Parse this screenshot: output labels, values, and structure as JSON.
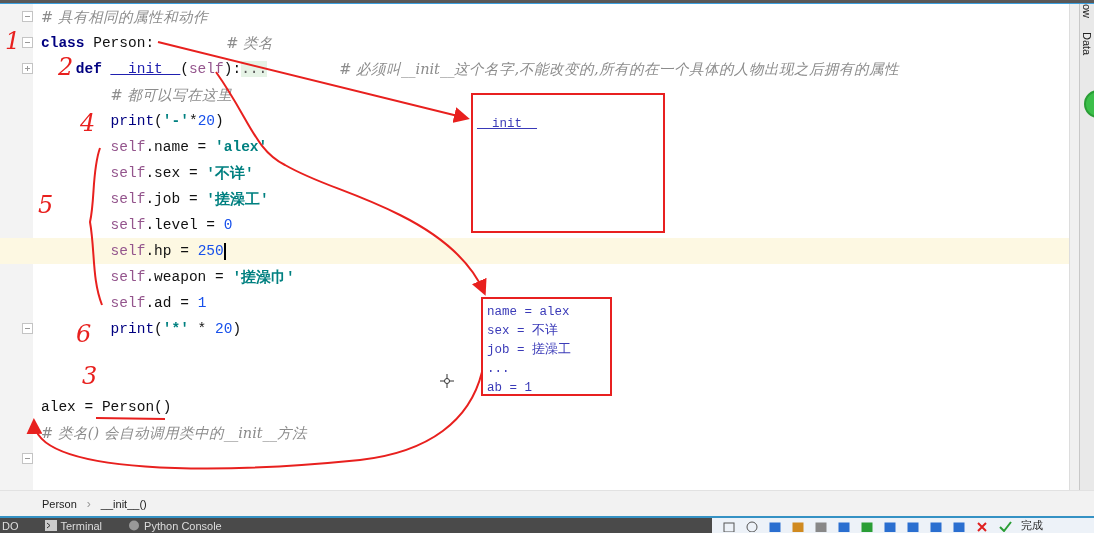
{
  "editor": {
    "lines": [
      {
        "fold_marker": true,
        "collapsed": false,
        "current": false,
        "tokens": [
          {
            "kind": "comment",
            "text": "# 具有相同的属性和动作"
          }
        ]
      },
      {
        "fold_marker": true,
        "collapsed": false,
        "current": false,
        "tokens": [
          {
            "kind": "keyword",
            "text": "class"
          },
          {
            "kind": "plain",
            "text": "Person:"
          },
          {
            "kind": "trailing_comment",
            "text": "# 类名"
          }
        ],
        "children": [
          {
            "fold_marker": true,
            "collapsed": true,
            "current": false,
            "tokens": [
              {
                "kind": "keyword",
                "text": "def"
              },
              {
                "kind": "magic",
                "text": "__init__"
              },
              {
                "kind": "plain",
                "text": "("
              },
              {
                "kind": "self",
                "text": "self"
              },
              {
                "kind": "plain",
                "text": "):"
              },
              {
                "kind": "folded",
                "text": "..."
              },
              {
                "kind": "trailing_comment",
                "text": "# 必须叫__init__这个名字,不能改变的,所有的在一个具体的人物出现之后拥有的属性"
              }
            ],
            "children": [
              {
                "fold_marker": false,
                "collapsed": false,
                "current": false,
                "tokens": [
                  {
                    "kind": "comment",
                    "text": "# 都可以写在这里"
                  }
                ]
              },
              {
                "fold_marker": false,
                "collapsed": false,
                "current": false,
                "tokens": [
                  {
                    "kind": "builtin",
                    "text": "print"
                  },
                  {
                    "kind": "plain",
                    "text": "("
                  },
                  {
                    "kind": "string",
                    "text": "'-'"
                  },
                  {
                    "kind": "plain",
                    "text": "*"
                  },
                  {
                    "kind": "number",
                    "text": "20"
                  },
                  {
                    "kind": "plain",
                    "text": ")"
                  }
                ]
              },
              {
                "fold_marker": false,
                "collapsed": false,
                "current": false,
                "tokens": [
                  {
                    "kind": "self",
                    "text": "self"
                  },
                  {
                    "kind": "plain",
                    "text": ".name = "
                  },
                  {
                    "kind": "string",
                    "text": "'alex'"
                  }
                ]
              },
              {
                "fold_marker": false,
                "collapsed": false,
                "current": false,
                "tokens": [
                  {
                    "kind": "self",
                    "text": "self"
                  },
                  {
                    "kind": "plain",
                    "text": ".sex = "
                  },
                  {
                    "kind": "string",
                    "text": "'不详'"
                  }
                ]
              },
              {
                "fold_marker": false,
                "collapsed": false,
                "current": false,
                "tokens": [
                  {
                    "kind": "self",
                    "text": "self"
                  },
                  {
                    "kind": "plain",
                    "text": ".job = "
                  },
                  {
                    "kind": "string",
                    "text": "'搓澡工'"
                  }
                ]
              },
              {
                "fold_marker": false,
                "collapsed": false,
                "current": false,
                "tokens": [
                  {
                    "kind": "self",
                    "text": "self"
                  },
                  {
                    "kind": "plain",
                    "text": ".level = "
                  },
                  {
                    "kind": "number",
                    "text": "0"
                  }
                ]
              },
              {
                "fold_marker": false,
                "collapsed": false,
                "current": true,
                "tokens": [
                  {
                    "kind": "self",
                    "text": "self"
                  },
                  {
                    "kind": "plain",
                    "text": ".hp = "
                  },
                  {
                    "kind": "number",
                    "text": "250"
                  }
                ]
              },
              {
                "fold_marker": false,
                "collapsed": false,
                "current": false,
                "tokens": [
                  {
                    "kind": "self",
                    "text": "self"
                  },
                  {
                    "kind": "plain",
                    "text": ".weapon = "
                  },
                  {
                    "kind": "string",
                    "text": "'搓澡巾'"
                  }
                ]
              },
              {
                "fold_marker": false,
                "collapsed": false,
                "current": false,
                "tokens": [
                  {
                    "kind": "self",
                    "text": "self"
                  },
                  {
                    "kind": "plain",
                    "text": ".ad = "
                  },
                  {
                    "kind": "number",
                    "text": "1"
                  }
                ]
              },
              {
                "fold_marker": true,
                "collapsed": false,
                "current": false,
                "tokens": [
                  {
                    "kind": "builtin",
                    "text": "print"
                  },
                  {
                    "kind": "plain",
                    "text": "("
                  },
                  {
                    "kind": "string",
                    "text": "'*'"
                  },
                  {
                    "kind": "plain",
                    "text": " * "
                  },
                  {
                    "kind": "number",
                    "text": "20"
                  },
                  {
                    "kind": "plain",
                    "text": ")"
                  }
                ]
              }
            ]
          }
        ]
      },
      {
        "fold_marker": false,
        "collapsed": false,
        "current": false
      },
      {
        "fold_marker": false,
        "collapsed": false,
        "current": false
      },
      {
        "fold_marker": false,
        "collapsed": false,
        "current": false,
        "tokens": [
          {
            "kind": "plain",
            "text": "alex = Person()"
          }
        ]
      },
      {
        "fold_marker": false,
        "collapsed": false,
        "current": false,
        "tokens": [
          {
            "kind": "comment",
            "text": "# 类名() 会自动调用类中的__init__方法"
          }
        ]
      },
      {
        "fold_marker": true,
        "collapsed": false,
        "current": false
      }
    ]
  },
  "annotations": {
    "markers": [
      "1",
      "2",
      "4",
      "5",
      "6",
      "3"
    ],
    "box_1": {
      "lines": [
        "__init__"
      ]
    },
    "box_2": {
      "lines": [
        "name = alex",
        "sex = 不详",
        "job = 搓澡工",
        "...",
        "ab = 1"
      ]
    }
  },
  "side_strip": {
    "labels": [
      "ow",
      "Data"
    ]
  },
  "breadcrumb": {
    "items": [
      "Person",
      "__init__()"
    ],
    "separator": "›"
  },
  "bottom_bar": {
    "tabs": [
      "DO",
      "Terminal",
      "Python Console"
    ],
    "toolbar_label": "完成"
  }
}
